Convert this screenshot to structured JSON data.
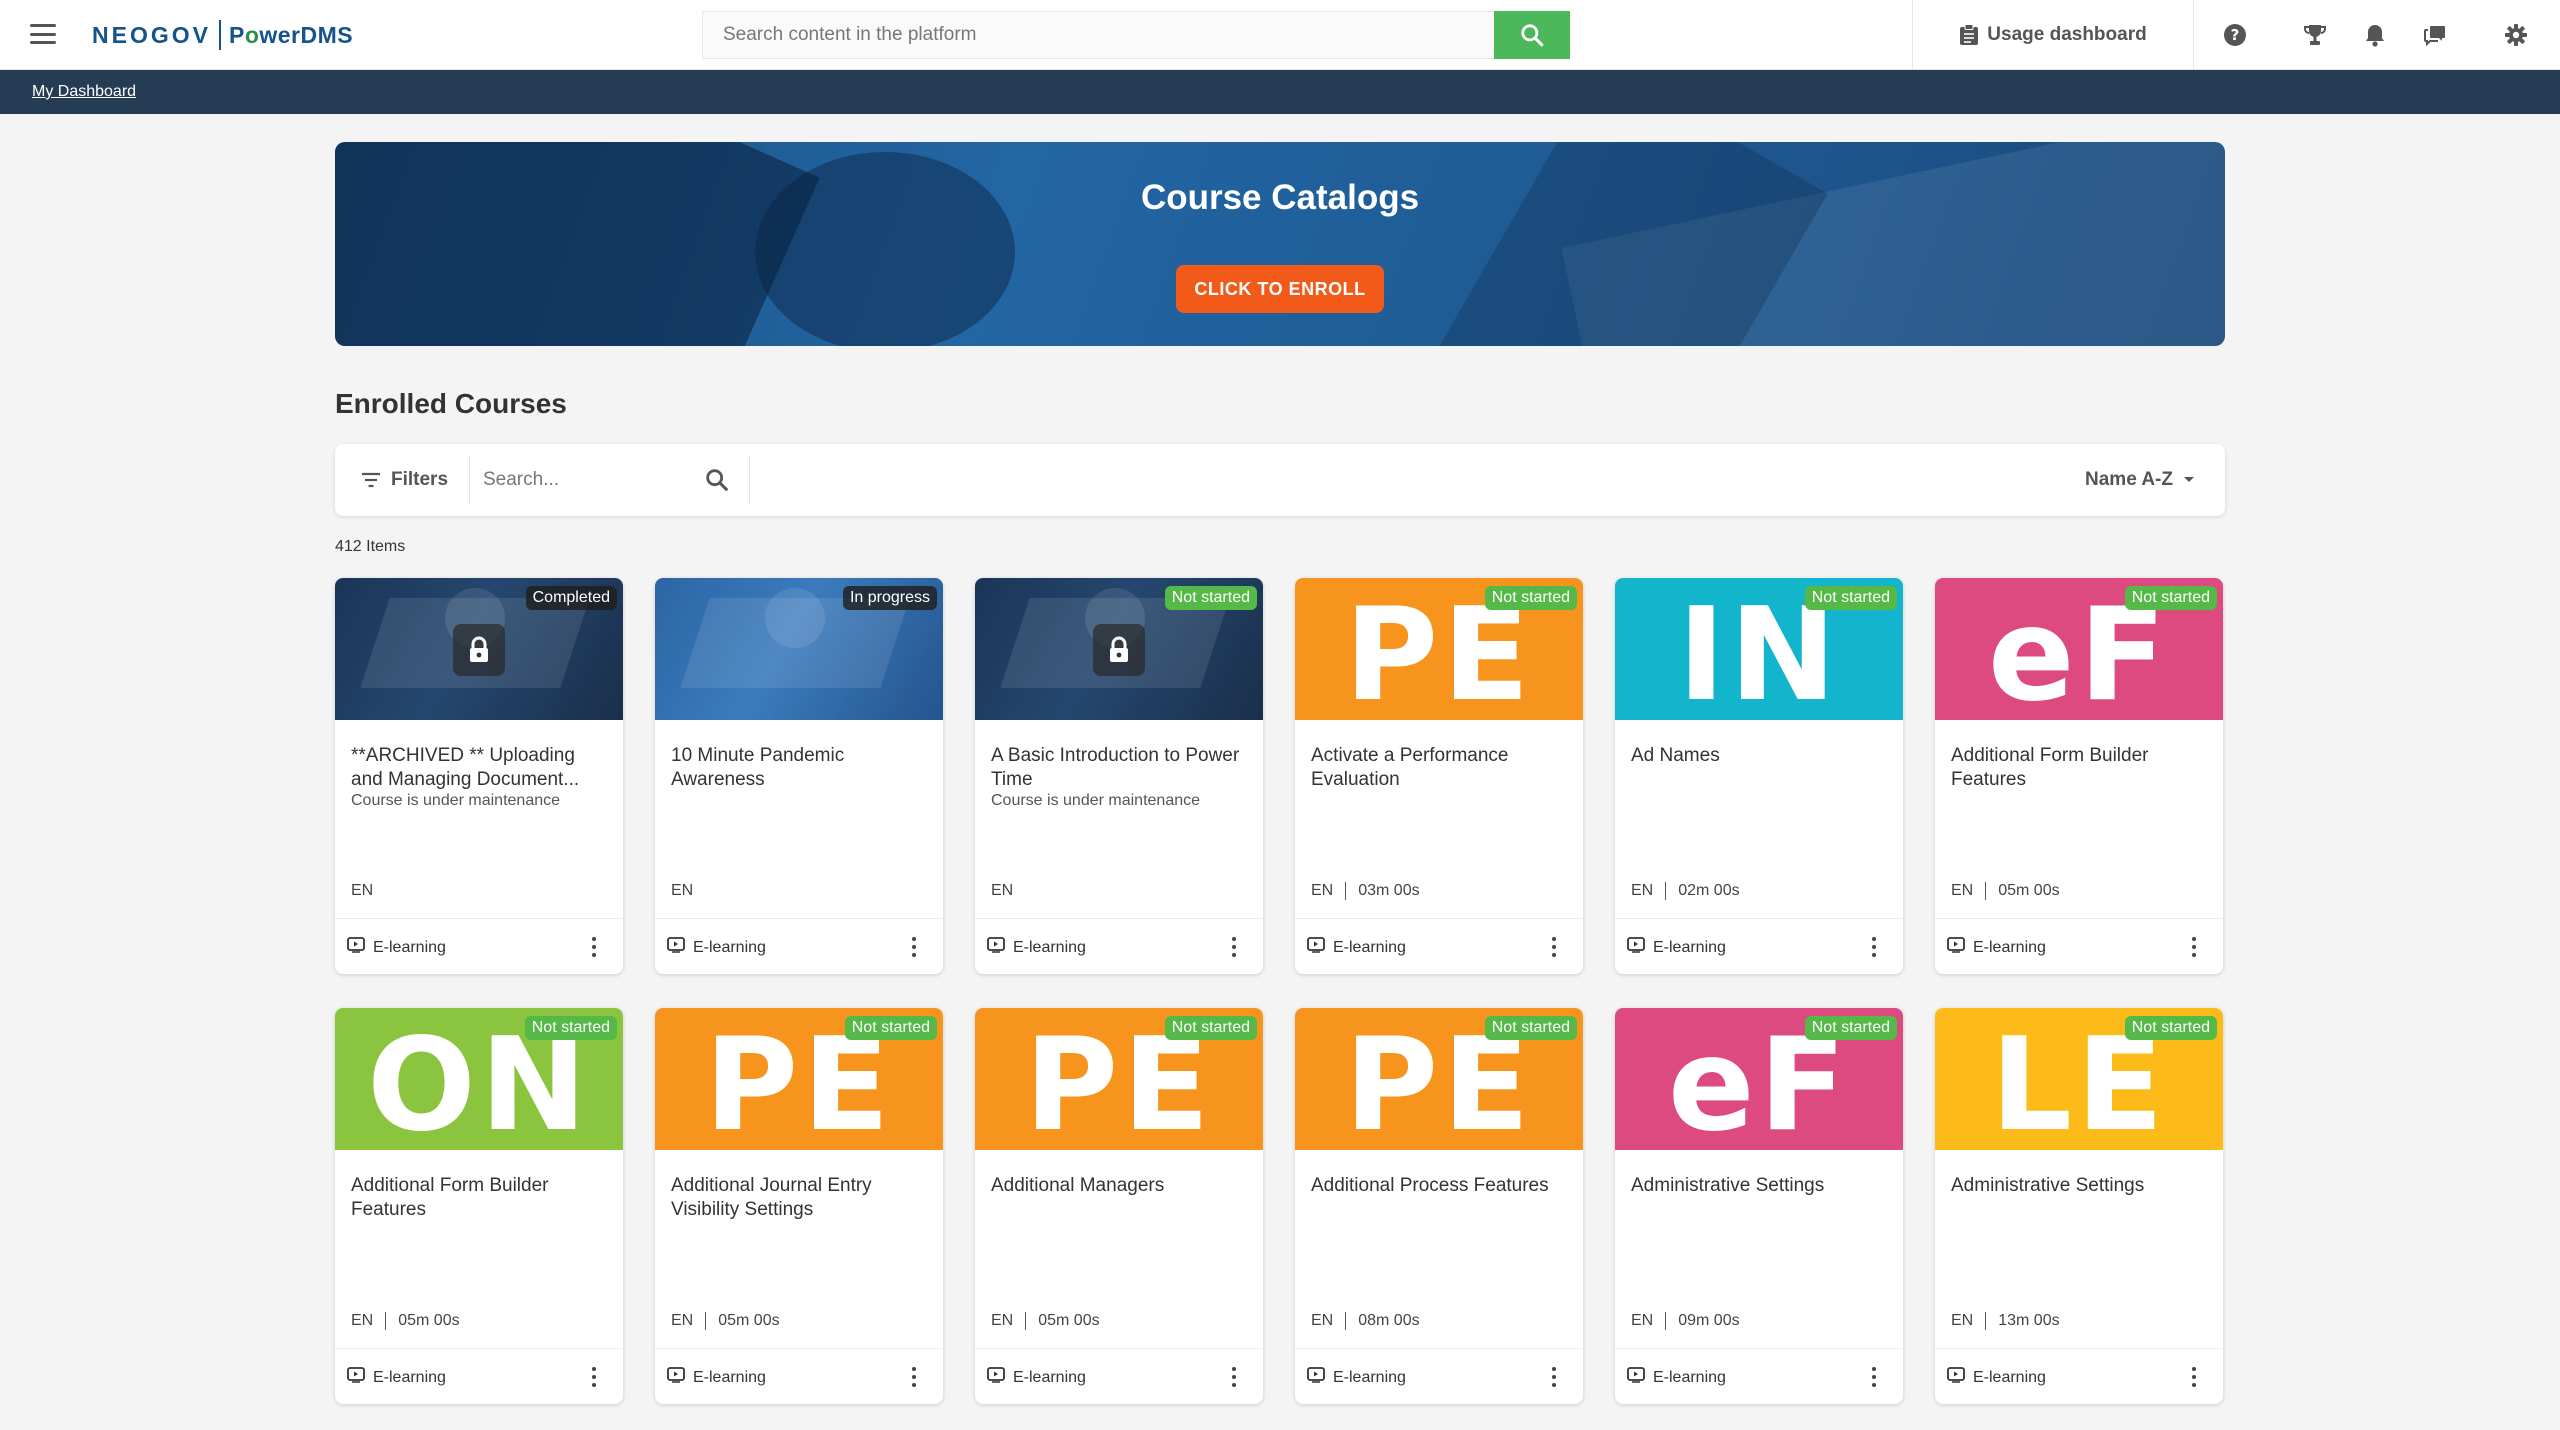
{
  "header": {
    "logo_left": "NEOGOV",
    "logo_right_pre": "P",
    "logo_right_o": "o",
    "logo_right_post": "werDMS",
    "search_placeholder": "Search content in the platform",
    "usage_label": "Usage dashboard",
    "icons": [
      "help-icon",
      "trophy-icon",
      "bell-icon",
      "chat-icon",
      "gear-icon"
    ]
  },
  "breadcrumb": {
    "label": "My Dashboard"
  },
  "hero": {
    "title": "Course Catalogs",
    "button": "CLICK TO ENROLL"
  },
  "section_title": "Enrolled Courses",
  "filterbar": {
    "filters_label": "Filters",
    "search_placeholder": "Search...",
    "sort_label": "Name A-Z"
  },
  "count_label": "412 Items",
  "colors": {
    "green": "#54b947",
    "orange": "#f7941d",
    "teal": "#12b5cb",
    "pink": "#dc4a80",
    "lime": "#8bc43f",
    "yellow": "#fdbb1a",
    "accent": "#f25a1a"
  },
  "courses": [
    {
      "title": "**ARCHIVED ** Uploading and Managing Document...",
      "subtitle": "Course is under maintenance",
      "status": "Completed",
      "badge": "dark",
      "thumb": "photo-dark",
      "letters": "",
      "locked": true,
      "lang": "EN",
      "duration": "",
      "type": "E-learning"
    },
    {
      "title": "10 Minute Pandemic Awareness",
      "subtitle": "",
      "status": "In progress",
      "badge": "dark",
      "thumb": "photo-blue",
      "letters": "",
      "locked": false,
      "lang": "EN",
      "duration": "",
      "type": "E-learning"
    },
    {
      "title": "A Basic Introduction to Power Time",
      "subtitle": "Course is under maintenance",
      "status": "Not started",
      "badge": "green",
      "thumb": "photo-dark",
      "letters": "",
      "locked": true,
      "lang": "EN",
      "duration": "",
      "type": "E-learning"
    },
    {
      "title": "Activate a Performance Evaluation",
      "subtitle": "",
      "status": "Not started",
      "badge": "green",
      "thumb": "#f7941d",
      "letters": "PE",
      "locked": false,
      "lang": "EN",
      "duration": "03m 00s",
      "type": "E-learning"
    },
    {
      "title": "Ad Names",
      "subtitle": "",
      "status": "Not started",
      "badge": "green",
      "thumb": "#12b5cb",
      "letters": "IN",
      "locked": false,
      "lang": "EN",
      "duration": "02m 00s",
      "type": "E-learning"
    },
    {
      "title": "Additional Form Builder Features",
      "subtitle": "",
      "status": "Not started",
      "badge": "green",
      "thumb": "#dc4a80",
      "letters": "eF",
      "locked": false,
      "lang": "EN",
      "duration": "05m 00s",
      "type": "E-learning"
    },
    {
      "title": "Additional Form Builder Features",
      "subtitle": "",
      "status": "Not started",
      "badge": "green",
      "thumb": "#8bc43f",
      "letters": "ON",
      "locked": false,
      "lang": "EN",
      "duration": "05m 00s",
      "type": "E-learning"
    },
    {
      "title": "Additional Journal Entry Visibility Settings",
      "subtitle": "",
      "status": "Not started",
      "badge": "green",
      "thumb": "#f7941d",
      "letters": "PE",
      "locked": false,
      "lang": "EN",
      "duration": "05m 00s",
      "type": "E-learning"
    },
    {
      "title": "Additional Managers",
      "subtitle": "",
      "status": "Not started",
      "badge": "green",
      "thumb": "#f7941d",
      "letters": "PE",
      "locked": false,
      "lang": "EN",
      "duration": "05m 00s",
      "type": "E-learning"
    },
    {
      "title": "Additional Process Features",
      "subtitle": "",
      "status": "Not started",
      "badge": "green",
      "thumb": "#f7941d",
      "letters": "PE",
      "locked": false,
      "lang": "EN",
      "duration": "08m 00s",
      "type": "E-learning"
    },
    {
      "title": "Administrative Settings",
      "subtitle": "",
      "status": "Not started",
      "badge": "green",
      "thumb": "#dc4a80",
      "letters": "eF",
      "locked": false,
      "lang": "EN",
      "duration": "09m 00s",
      "type": "E-learning"
    },
    {
      "title": "Administrative Settings",
      "subtitle": "",
      "status": "Not started",
      "badge": "green",
      "thumb": "#fdbb1a",
      "letters": "LE",
      "locked": false,
      "lang": "EN",
      "duration": "13m 00s",
      "type": "E-learning"
    }
  ]
}
